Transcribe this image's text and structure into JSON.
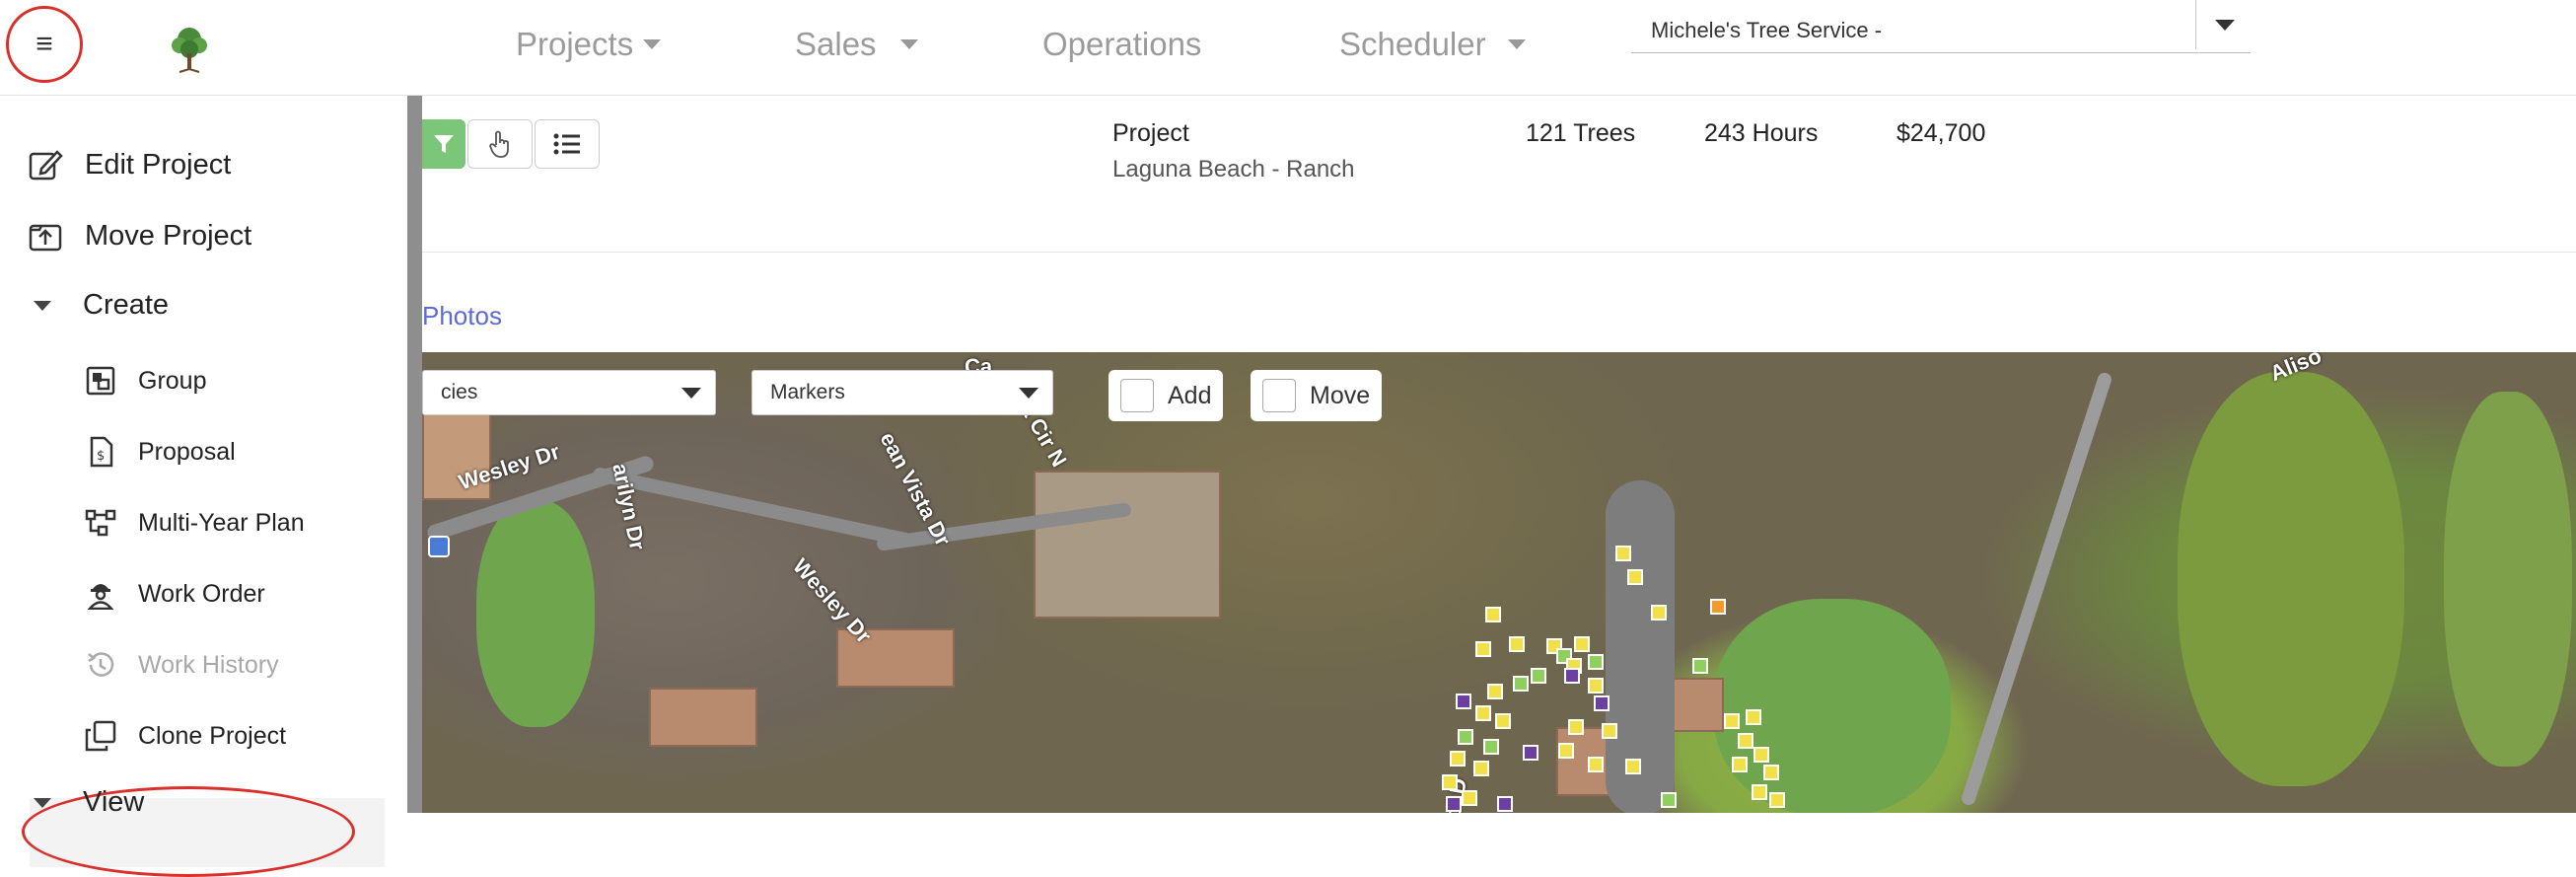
{
  "header": {
    "menu_icon": "hamburger-icon",
    "logo_icon": "tree-logo-icon",
    "nav": [
      {
        "label": "Projects",
        "has_dropdown": true
      },
      {
        "label": "Sales",
        "has_dropdown": true
      },
      {
        "label": "Operations",
        "has_dropdown": false
      },
      {
        "label": "Scheduler",
        "has_dropdown": true
      }
    ],
    "company_select": {
      "value": "Michele's Tree Service -"
    }
  },
  "sidebar": {
    "items": [
      {
        "label": "Edit Project",
        "icon": "edit-icon"
      },
      {
        "label": "Move Project",
        "icon": "move-upload-icon"
      }
    ],
    "create_section": {
      "label": "Create",
      "items": [
        {
          "label": "Group",
          "icon": "group-icon",
          "disabled": false
        },
        {
          "label": "Proposal",
          "icon": "proposal-document-icon",
          "disabled": false
        },
        {
          "label": "Multi-Year Plan",
          "icon": "plan-tree-icon",
          "disabled": false
        },
        {
          "label": "Work Order",
          "icon": "worker-icon",
          "disabled": false
        },
        {
          "label": "Work History",
          "icon": "history-icon",
          "disabled": true
        },
        {
          "label": "Clone Project",
          "icon": "clone-icon",
          "disabled": false
        }
      ]
    },
    "view_section": {
      "label": "View"
    }
  },
  "project_header": {
    "tools": [
      "filter-icon",
      "pointer-hand-icon",
      "list-icon"
    ],
    "label": "Project",
    "name": "Laguna Beach - Ranch",
    "stats": {
      "trees": "121 Trees",
      "hours": "243 Hours",
      "price": "$24,700"
    }
  },
  "tabs": {
    "photos_link": "Photos"
  },
  "map": {
    "species_dropdown": "cies",
    "markers_dropdown": "Markers",
    "add_label": "Add",
    "move_label": "Move",
    "street_labels": [
      "Wesley Dr",
      "Wesley Dr",
      "arilyn Dr",
      "ean Vista Dr",
      "a Cir N",
      "Ca",
      "Aliso",
      "ol D"
    ],
    "marker_colors": {
      "yellow": "#f1e04a",
      "purple": "#6d3fa0",
      "green": "#8fcf5d",
      "orange": "#f39a2a"
    }
  },
  "annotation_color": "#d9302c"
}
